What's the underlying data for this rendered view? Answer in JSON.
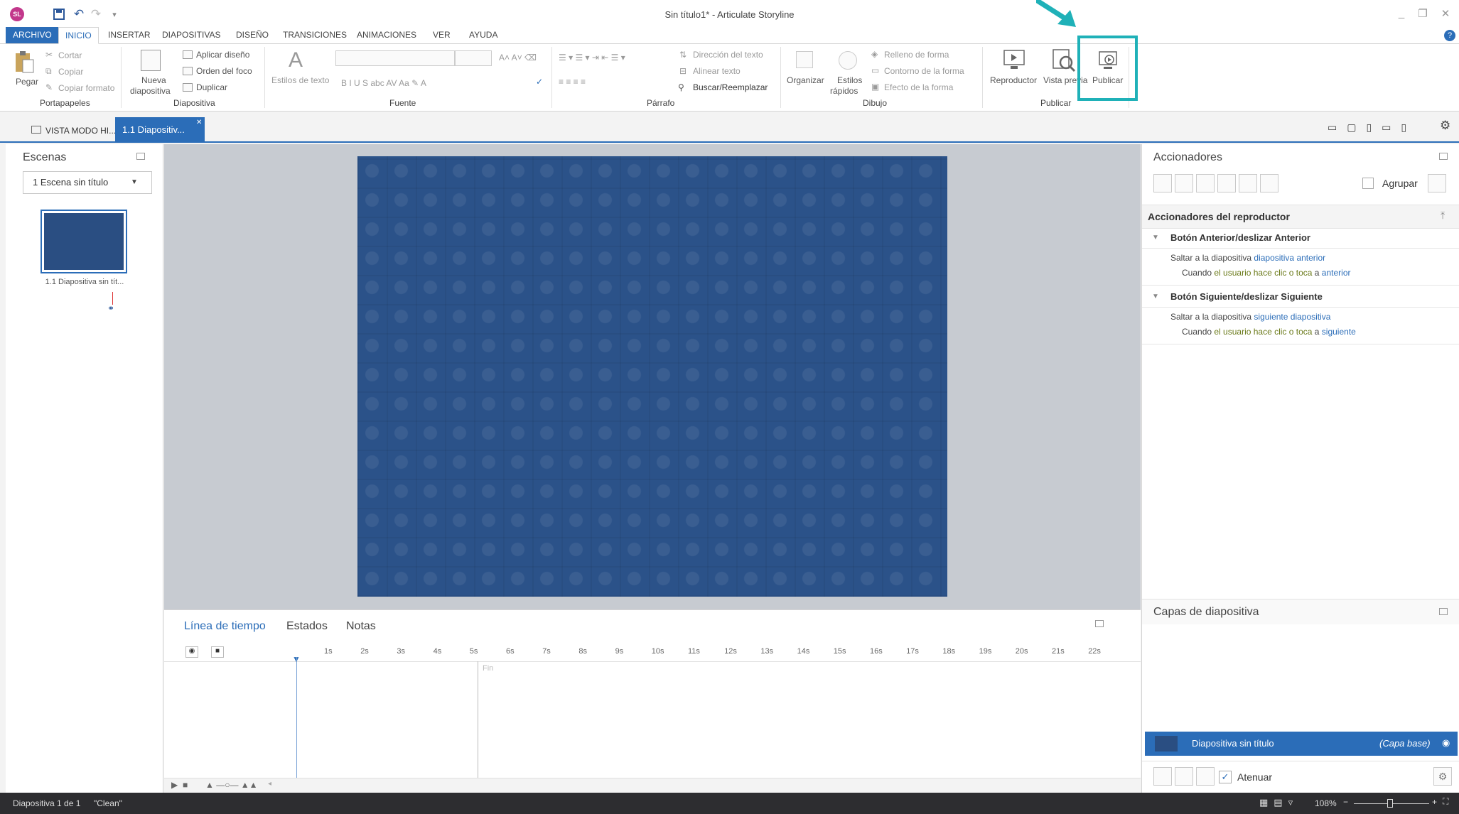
{
  "app": {
    "title": "Sin título1* - Articulate Storyline",
    "logo": "SL"
  },
  "ribbon_tabs": [
    "ARCHIVO",
    "INICIO",
    "INSERTAR",
    "DIAPOSITIVAS",
    "DISEÑO",
    "TRANSICIONES",
    "ANIMACIONES",
    "VER",
    "AYUDA"
  ],
  "ribbon": {
    "portapapeles": {
      "pegar": "Pegar",
      "cortar": "Cortar",
      "copiar": "Copiar",
      "copiar_formato": "Copiar formato",
      "group": "Portapapeles"
    },
    "diapositiva": {
      "nueva1": "Nueva",
      "nueva2": "diapositiva",
      "aplicar": "Aplicar diseño",
      "orden": "Orden del foco",
      "duplicar": "Duplicar",
      "group": "Diapositiva"
    },
    "fuente": {
      "estilos": "Estilos de texto",
      "group": "Fuente"
    },
    "parrafo": {
      "direccion": "Dirección del texto",
      "alinear": "Alinear texto",
      "buscar": "Buscar/Reemplazar",
      "group": "Párrafo"
    },
    "dibujo": {
      "organizar": "Organizar",
      "estilos1": "Estilos",
      "estilos2": "rápidos",
      "relleno": "Relleno de forma",
      "contorno": "Contorno de la forma",
      "efecto": "Efecto de la forma",
      "group": "Dibujo"
    },
    "publicar": {
      "reproductor": "Reproductor",
      "vista_previa": "Vista previa",
      "publicar": "Publicar",
      "group": "Publicar"
    }
  },
  "doc_tabs": {
    "vista": "VISTA MODO HI...",
    "slide": "1.1 Diapositiv..."
  },
  "scenes": {
    "title": "Escenas",
    "selected": "1 Escena sin título",
    "thumb_label": "1.1 Diapositiva sin tít..."
  },
  "timeline": {
    "tabs": [
      "Línea de tiempo",
      "Estados",
      "Notas"
    ],
    "ticks": [
      "1s",
      "2s",
      "3s",
      "4s",
      "5s",
      "6s",
      "7s",
      "8s",
      "9s",
      "10s",
      "11s",
      "12s",
      "13s",
      "14s",
      "15s",
      "16s",
      "17s",
      "18s",
      "19s",
      "20s",
      "21s",
      "22s"
    ],
    "end_label": "Fin"
  },
  "triggers": {
    "title": "Accionadores",
    "group_label": "Agrupar",
    "section": "Accionadores del reproductor",
    "items": [
      {
        "name": "Botón Anterior/deslizar Anterior",
        "line1_a": "Saltar a la diapositiva ",
        "line1_b": "diapositiva anterior",
        "line2_a": "Cuando ",
        "line2_b": "el usuario hace clic o toca",
        "line2_c": " a ",
        "line2_d": "anterior"
      },
      {
        "name": "Botón Siguiente/deslizar Siguiente",
        "line1_a": "Saltar a la diapositiva ",
        "line1_b": "siguiente diapositiva",
        "line2_a": "Cuando ",
        "line2_b": "el usuario hace clic o toca",
        "line2_c": " a ",
        "line2_d": "siguiente"
      }
    ]
  },
  "layers": {
    "title": "Capas de diapositiva",
    "base_name": "Diapositiva sin título",
    "base_tag": "(Capa base)",
    "dim_label": "Atenuar"
  },
  "status": {
    "slide": "Diapositiva 1 de 1",
    "theme": "\"Clean\"",
    "zoom": "108%"
  },
  "colors": {
    "accent": "#2b6db8",
    "slide_bg": "#2b5289",
    "callout": "#1fb1b8"
  }
}
